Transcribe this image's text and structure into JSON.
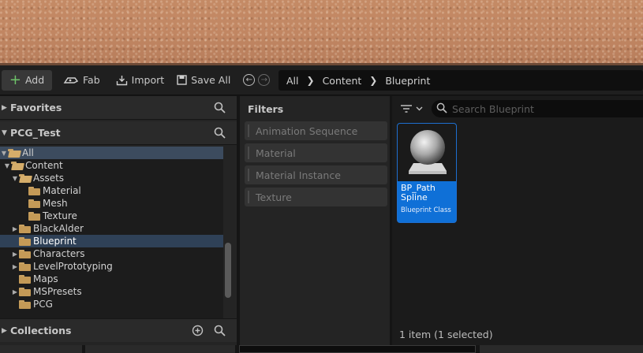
{
  "toolbar": {
    "add_label": "Add",
    "fab_label": "Fab",
    "import_label": "Import",
    "save_all_label": "Save All"
  },
  "breadcrumb": [
    "All",
    "Content",
    "Blueprint"
  ],
  "left_panel": {
    "favorites_label": "Favorites",
    "project_label": "PCG_Test",
    "collections_label": "Collections",
    "tree": [
      {
        "label": "All",
        "depth": 0,
        "expanded": true,
        "state": "highlight"
      },
      {
        "label": "Content",
        "depth": 1,
        "expanded": true,
        "state": ""
      },
      {
        "label": "Assets",
        "depth": 2,
        "expanded": true,
        "state": ""
      },
      {
        "label": "Material",
        "depth": 3,
        "expanded": false,
        "state": "",
        "leaf": true
      },
      {
        "label": "Mesh",
        "depth": 3,
        "expanded": false,
        "state": "",
        "leaf": true
      },
      {
        "label": "Texture",
        "depth": 3,
        "expanded": false,
        "state": "",
        "leaf": true
      },
      {
        "label": "BlackAlder",
        "depth": 2,
        "expanded": false,
        "state": ""
      },
      {
        "label": "Blueprint",
        "depth": 2,
        "expanded": false,
        "state": "selected",
        "leaf": true
      },
      {
        "label": "Characters",
        "depth": 2,
        "expanded": false,
        "state": ""
      },
      {
        "label": "LevelPrototyping",
        "depth": 2,
        "expanded": false,
        "state": ""
      },
      {
        "label": "Maps",
        "depth": 2,
        "expanded": false,
        "state": "",
        "leaf": true
      },
      {
        "label": "MSPresets",
        "depth": 2,
        "expanded": false,
        "state": ""
      },
      {
        "label": "PCG",
        "depth": 2,
        "expanded": false,
        "state": "",
        "leaf": true
      }
    ]
  },
  "filters": {
    "title": "Filters",
    "items": [
      "Animation Sequence",
      "Material",
      "Material Instance",
      "Texture"
    ]
  },
  "content": {
    "search_placeholder": "Search Blueprint",
    "asset": {
      "name": "BP_Path Spline",
      "type": "Blueprint Class"
    },
    "status": "1 item (1 selected)"
  }
}
